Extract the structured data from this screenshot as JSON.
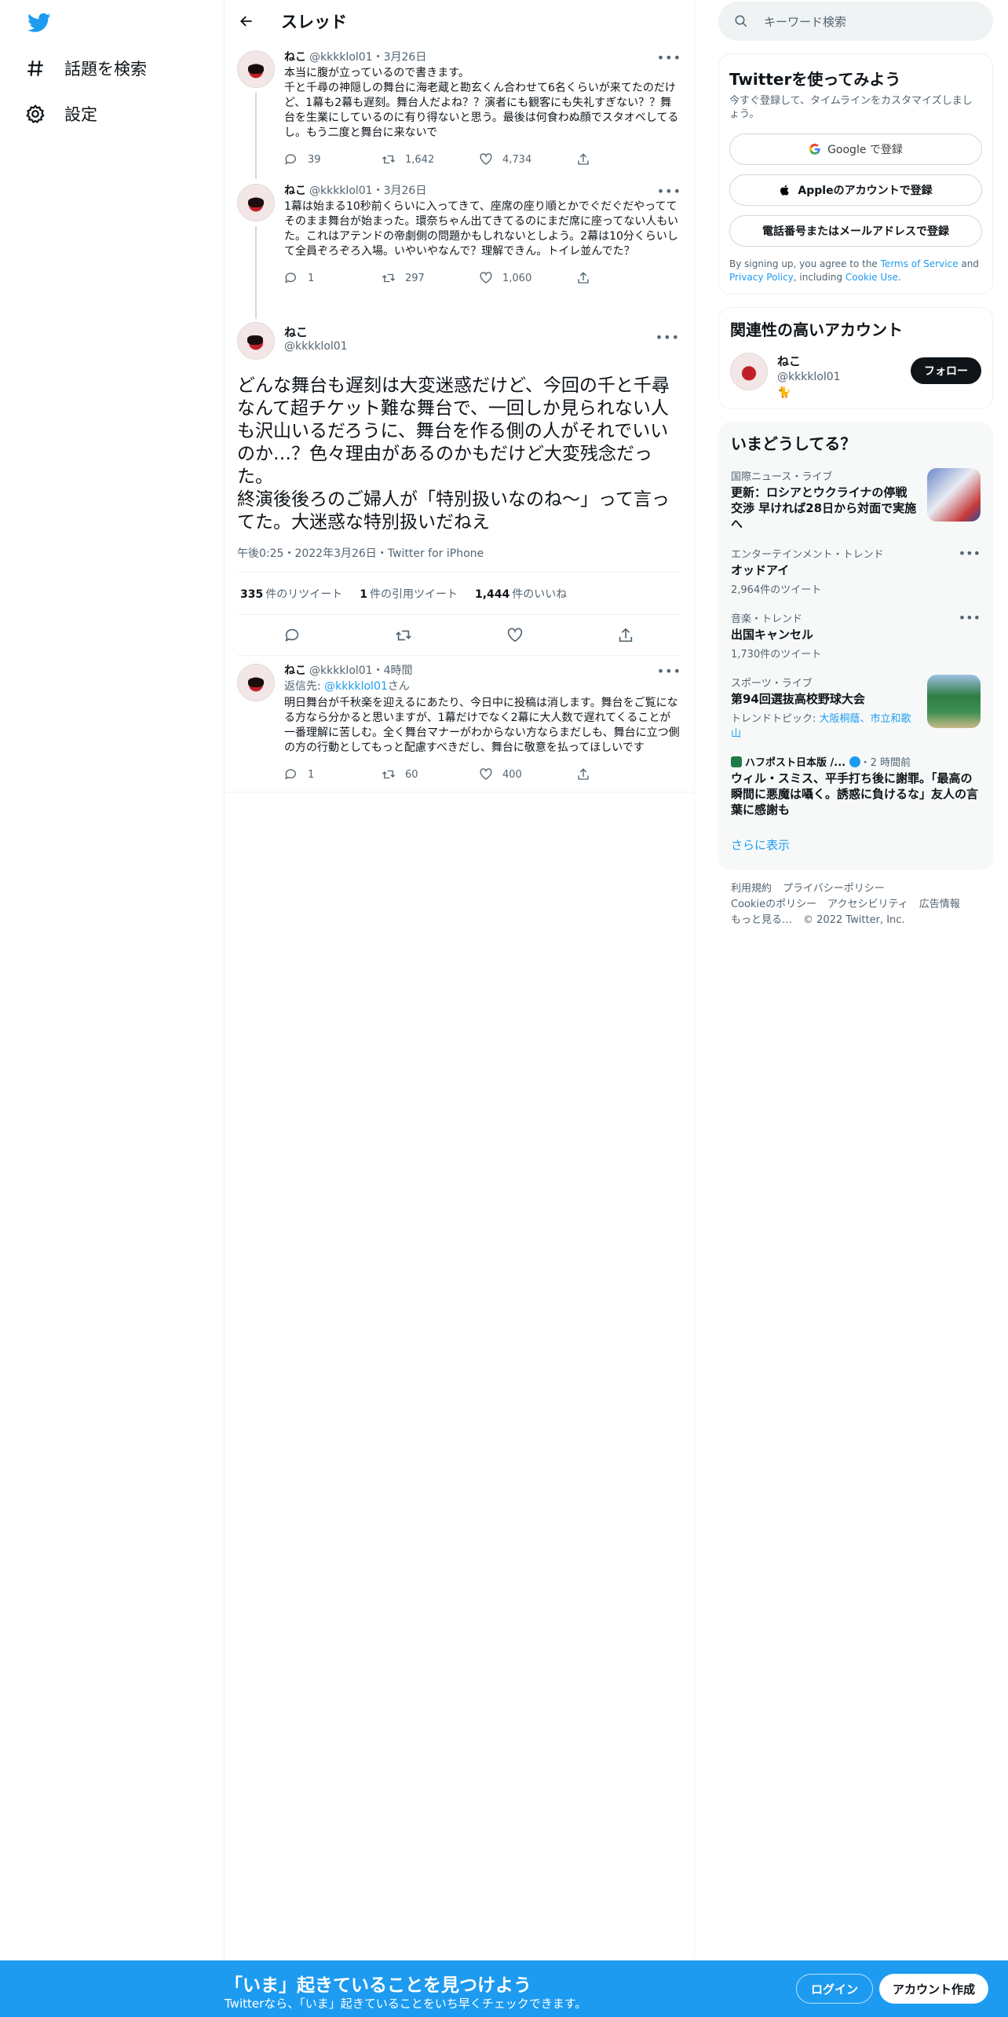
{
  "nav": {
    "explore": "話題を検索",
    "settings": "設定"
  },
  "header": {
    "title": "スレッド"
  },
  "tweets": [
    {
      "name": "ねこ",
      "handle": "@kkkklol01",
      "date": "・3月26日",
      "text": "本当に腹が立っているので書きます。\n千と千尋の神隠しの舞台に海老蔵と勘玄くん合わせて6名くらいが来てたのだけど、1幕も2幕も遅刻。舞台人だよね？？演者にも観客にも失礼すぎない？？舞台を生業にしているのに有り得ないと思う。最後は何食わぬ顔でスタオベしてるし。もう二度と舞台に来ないで",
      "replies": "39",
      "retweets": "1,642",
      "likes": "4,734"
    },
    {
      "name": "ねこ",
      "handle": "@kkkklol01",
      "date": "・3月26日",
      "text": "1幕は始まる10秒前くらいに入ってきて、座席の座り順とかでぐだぐだやっててそのまま舞台が始まった。環奈ちゃん出てきてるのにまだ席に座ってない人もいた。これはアテンドの帝劇側の問題かもしれないとしよう。2幕は10分くらいして全員ぞろぞろ入場。いやいやなんで？理解できん。トイレ並んでた？",
      "replies": "1",
      "retweets": "297",
      "likes": "1,060"
    }
  ],
  "focus": {
    "name": "ねこ",
    "handle": "@kkkklol01",
    "text": "どんな舞台も遅刻は大変迷惑だけど、今回の千と千尋なんて超チケット難な舞台で、一回しか見られない人も沢山いるだろうに、舞台を作る側の人がそれでいいのか…？色々理由があるのかもだけど大変残念だった。\n終演後後ろのご婦人が「特別扱いなのね〜」って言ってた。大迷惑な特別扱いだねえ",
    "meta": "午後0:25・2022年3月26日・Twitter for iPhone",
    "rt_count": "335",
    "rt_label": "件のリツイート",
    "qt_count": "1",
    "qt_label": "件の引用ツイート",
    "like_count": "1,444",
    "like_label": "件のいいね"
  },
  "reply": {
    "name": "ねこ",
    "handle": "@kkkklol01",
    "date": "・4時間",
    "replying_prefix": "返信先: ",
    "replying_to": "@kkkklol01",
    "replying_suffix": "さん",
    "text": "明日舞台が千秋楽を迎えるにあたり、今日中に投稿は消します。舞台をご覧になる方なら分かると思いますが、1幕だけでなく2幕に大人数で遅れてくることが一番理解に苦しむ。全く舞台マナーがわからない方ならまだしも、舞台に立つ側の方の行動としてもっと配慮すべきだし、舞台に敬意を払ってほしいです",
    "replies": "1",
    "retweets": "60",
    "likes": "400"
  },
  "search": {
    "placeholder": "キーワード検索"
  },
  "signup": {
    "title": "Twitterを使ってみよう",
    "subtitle": "今すぐ登録して、タイムラインをカスタマイズしましょう。",
    "google": "Google で登録",
    "apple": "Appleのアカウントで登録",
    "phone": "電話番号またはメールアドレスで登録",
    "terms_a": "By signing up, you agree to the ",
    "terms_link1": "Terms of Service",
    "terms_b": " and ",
    "terms_link2": "Privacy Policy",
    "terms_c": ", including ",
    "terms_link3": "Cookie Use",
    "terms_d": "."
  },
  "related": {
    "title": "関連性の高いアカウント",
    "name": "ねこ",
    "handle": "@kkkklol01",
    "emoji": "🐈",
    "follow": "フォロー"
  },
  "trends": {
    "title": "いまどうしてる？",
    "items": [
      {
        "cat": "国際ニュース・ライブ",
        "title": "更新：ロシアとウクライナの停戦交渉 早ければ28日から対面で実施へ",
        "count": "",
        "thumb": true
      },
      {
        "cat": "エンターテインメント・トレンド",
        "title": "オッドアイ",
        "count": "2,964件のツイート",
        "thumb": false
      },
      {
        "cat": "音楽・トレンド",
        "title": "出国キャンセル",
        "count": "1,730件のツイート",
        "thumb": false
      },
      {
        "cat": "スポーツ・ライブ",
        "title": "第94回選抜高校野球大会",
        "count": "",
        "topics_label": "トレンドトピック: ",
        "topics": "大阪桐蔭、市立和歌山",
        "thumb": true
      },
      {
        "cat": "ハフポスト日本版 /...",
        "cat_time": "・2 時間前",
        "title": "ウィル・スミス、平手打ち後に謝罪。「最高の瞬間に悪魔は囁く。誘惑に負けるな」友人の言葉に感謝も",
        "count": "",
        "thumb": false
      }
    ],
    "show_more": "さらに表示"
  },
  "footer": {
    "links": [
      "利用規約",
      "プライバシーポリシー",
      "Cookieのポリシー",
      "アクセシビリティ",
      "広告情報",
      "もっと見る…"
    ],
    "copyright": "© 2022 Twitter, Inc."
  },
  "bottom": {
    "title": "「いま」起きていることを見つけよう",
    "subtitle": "Twitterなら、「いま」起きていることをいち早くチェックできます。",
    "login": "ログイン",
    "signup": "アカウント作成"
  },
  "colors": {
    "accent": "#1d9bf0",
    "text": "#0f1419",
    "muted": "#536471"
  }
}
